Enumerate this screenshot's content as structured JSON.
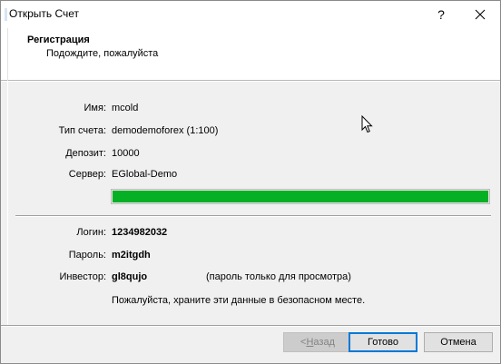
{
  "window": {
    "title": "Открыть Счет",
    "help_glyph": "?"
  },
  "header": {
    "title": "Регистрация",
    "subtitle": "Подождите, пожалуйста"
  },
  "account": {
    "name_label": "Имя:",
    "name_value": "mcold",
    "type_label": "Тип счета:",
    "type_value": "demodemoforex (1:100)",
    "deposit_label": "Депозит:",
    "deposit_value": "10000",
    "server_label": "Сервер:",
    "server_value": "EGlobal-Demo"
  },
  "progress": {
    "value": 1.0,
    "color": "#06b025"
  },
  "credentials": {
    "login_label": "Логин:",
    "login_value": "1234982032",
    "password_label": "Пароль:",
    "password_value": "m2itgdh",
    "investor_label": "Инвестор:",
    "investor_value": "gl8qujo",
    "investor_note": "(пароль только для просмотра)",
    "store_message": "Пожалуйста, храните эти данные в безопасном месте."
  },
  "buttons": {
    "back_prefix": "< ",
    "back_access": "Н",
    "back_rest": "азад",
    "finish_label": "Готово",
    "cancel_label": "Отмена",
    "default_border_color": "#0078d7"
  },
  "icons": {
    "close": "close-icon",
    "cursor": "mouse-pointer-icon",
    "app": "app-icon"
  }
}
